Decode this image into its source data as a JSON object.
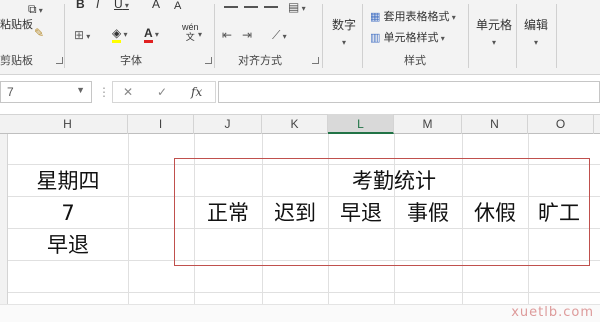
{
  "ribbon": {
    "clipboard": {
      "paste_label": "粘贴板",
      "partial_label": "剪贴板"
    },
    "font": {
      "bold": "B",
      "italic": "I",
      "underline": "U",
      "grow": "A",
      "shrink": "A",
      "font_color": "A",
      "phonetic": "wén",
      "phonetic_sub": "文",
      "label": "字体"
    },
    "alignment": {
      "label": "对齐方式"
    },
    "number": {
      "label": "数字"
    },
    "styles": {
      "table_format": "套用表格格式",
      "cell_styles": "单元格样式",
      "label": "样式"
    },
    "cells": {
      "label": "单元格"
    },
    "editing": {
      "label": "编辑"
    }
  },
  "formula_bar": {
    "name_box": "7",
    "cancel": "✕",
    "enter": "✓",
    "fx": "fx",
    "value": ""
  },
  "columns": [
    "H",
    "I",
    "J",
    "K",
    "L",
    "M",
    "N",
    "O"
  ],
  "selected_column": "L",
  "cells": {
    "h_day": "星期四",
    "h_num": "7",
    "h_status": "早退",
    "title": "考勤统计",
    "headers": [
      "正常",
      "迟到",
      "早退",
      "事假",
      "休假",
      "旷工"
    ]
  },
  "watermark": "xuetlb.com"
}
